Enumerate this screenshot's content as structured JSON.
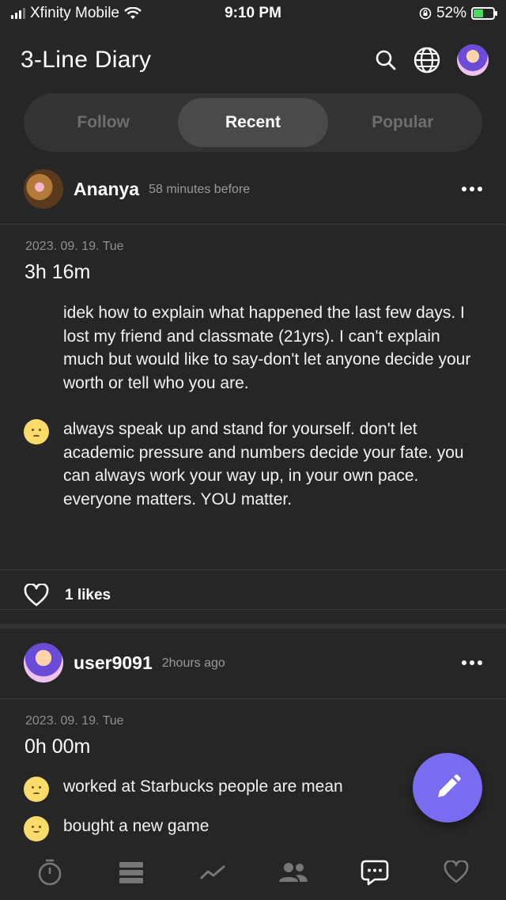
{
  "status": {
    "carrier": "Xfinity Mobile",
    "time": "9:10 PM",
    "battery": "52%"
  },
  "header": {
    "title": "3-Line Diary"
  },
  "tabs": [
    {
      "label": "Follow",
      "active": false
    },
    {
      "label": "Recent",
      "active": true
    },
    {
      "label": "Popular",
      "active": false
    }
  ],
  "posts": [
    {
      "user": "Ananya",
      "time": "58 minutes before",
      "date": "2023. 09. 19. Tue",
      "duration": "3h 16m",
      "entries": [
        {
          "text": "idek how to explain what happened the last few days. I lost my friend and classmate (21yrs). I can't explain much but would like to say-don't let anyone decide your worth or tell who you are.",
          "emoji": ""
        },
        {
          "text": "always speak up and stand for yourself. don't let academic pressure and numbers decide your fate. you can always work your way up, in your own pace.\neveryone matters. YOU matter.",
          "emoji": "sad-face-icon"
        }
      ],
      "likes": "1 likes"
    },
    {
      "user": "user9091",
      "time": "2hours ago",
      "date": "2023. 09. 19. Tue",
      "duration": "0h 00m",
      "entries": [
        {
          "text": "worked at Starbucks people are mean",
          "emoji": "sad-face-icon"
        },
        {
          "text": "bought a new game",
          "emoji": "happy-face-icon"
        }
      ]
    }
  ],
  "nav": [
    "timer-icon",
    "list-icon",
    "chart-icon",
    "people-icon",
    "chat-icon",
    "heart-icon"
  ],
  "colors": {
    "background": "#262626",
    "accent": "#7a6cf0",
    "tab_active": "#4a4a4a"
  }
}
